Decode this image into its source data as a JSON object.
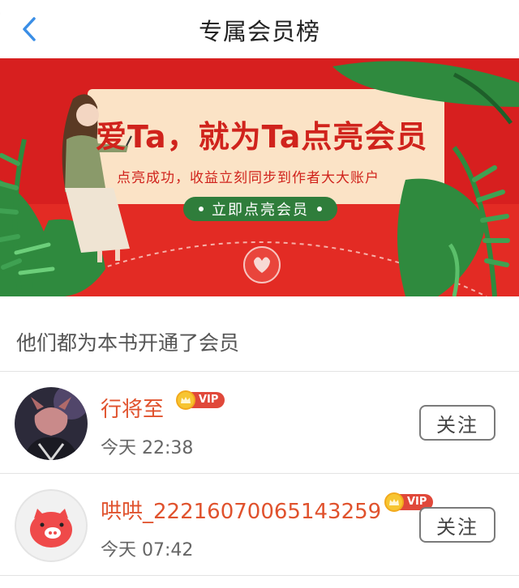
{
  "header": {
    "title": "专属会员榜",
    "back_icon": "chevron-left-icon"
  },
  "banner": {
    "title": "爱Ta，就为Ta点亮会员",
    "subtitle": "点亮成功，收益立刻同步到作者大大账户",
    "button_label": "立即点亮会员",
    "colors": {
      "background": "#d71f1f",
      "card": "#fbe3c6",
      "leaf": "#2f8a3e",
      "button": "#2f7d3b"
    }
  },
  "section": {
    "heading": "他们都为本书开通了会员"
  },
  "members": [
    {
      "name": "行将至",
      "badge": "VIP",
      "time": "今天 22:38",
      "follow_label": "关注"
    },
    {
      "name": "哄哄_22216070065143259",
      "badge": "VIP",
      "time": "今天 07:42",
      "follow_label": "关注"
    }
  ],
  "colors": {
    "accent": "#e0522d",
    "vip_tag": "#e0483a",
    "back_icon": "#3a8ee6"
  }
}
